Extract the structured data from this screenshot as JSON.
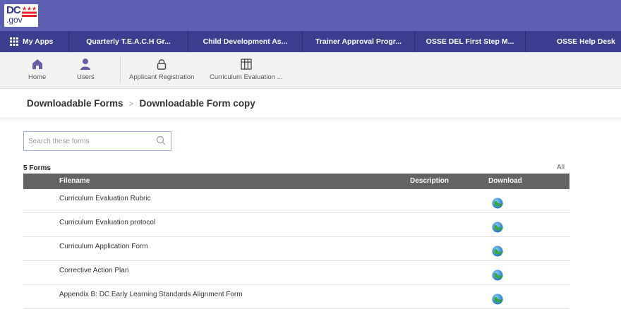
{
  "header": {
    "logo_main": "DC",
    "logo_sub": ".gov"
  },
  "appbar": {
    "items": [
      {
        "label": "My Apps",
        "icon": "grid-icon"
      },
      {
        "label": "Quarterly T.E.A.C.H Gr..."
      },
      {
        "label": "Child Development As..."
      },
      {
        "label": "Trainer Approval Progr..."
      },
      {
        "label": "OSSE DEL First Step M..."
      },
      {
        "label": "OSSE Help Desk"
      }
    ]
  },
  "toolbar": {
    "items": [
      {
        "label": "Home",
        "icon": "home-icon"
      },
      {
        "label": "Users",
        "icon": "user-icon"
      },
      {
        "label": "Applicant Registration",
        "icon": "lock-icon"
      },
      {
        "label": "Curriculum Evaluation ...",
        "icon": "table-icon"
      }
    ]
  },
  "breadcrumb": {
    "parent": "Downloadable Forms",
    "separator": ">",
    "current": "Downloadable Form copy"
  },
  "search": {
    "placeholder": "Search these forms",
    "value": ""
  },
  "list": {
    "count_label": "5 Forms",
    "filter_label": "All",
    "columns": {
      "filename": "Filename",
      "description": "Description",
      "download": "Download"
    },
    "rows": [
      {
        "filename": "Curriculum Evaluation Rubric",
        "description": ""
      },
      {
        "filename": "Curriculum Evaluation protocol",
        "description": ""
      },
      {
        "filename": "Curriculum Application Form",
        "description": ""
      },
      {
        "filename": "Corrective Action Plan",
        "description": ""
      },
      {
        "filename": "Appendix B: DC Early Learning Standards Alignment Form",
        "description": ""
      }
    ]
  },
  "colors": {
    "header_bg": "#5d5fb1",
    "appbar_bg": "#3b3d8f",
    "toolbar_icon": "#6b5aa6",
    "table_header_bg": "#636363",
    "flag_red": "#e3242b"
  }
}
